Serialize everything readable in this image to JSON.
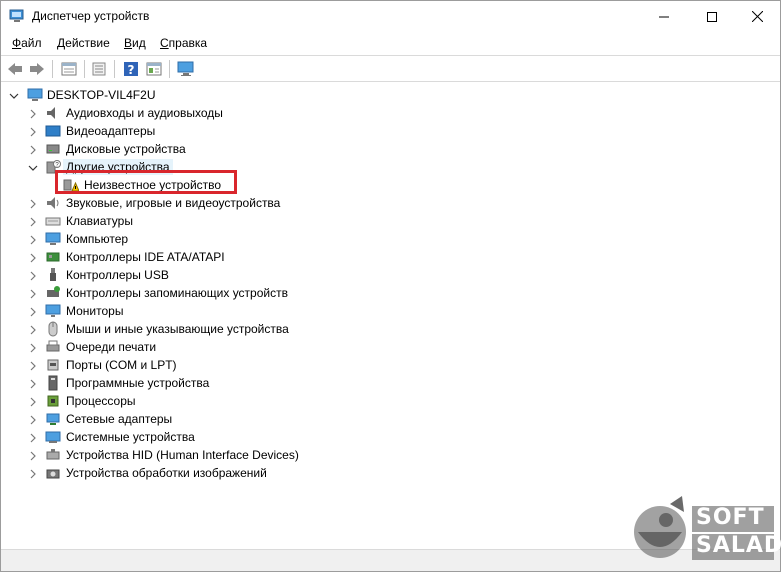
{
  "window": {
    "title": "Диспетчер устройств",
    "buttons": {
      "minimize": "minimize",
      "maximize": "maximize",
      "close": "close"
    }
  },
  "menu": {
    "items": [
      {
        "label_first": "Ф",
        "label_rest": "айл"
      },
      {
        "label_first": "Д",
        "label_rest": "ействие"
      },
      {
        "label_first": "В",
        "label_rest": "ид"
      },
      {
        "label_first": "С",
        "label_rest": "правка"
      }
    ]
  },
  "toolbar": {
    "icons": [
      "back-arrow-icon",
      "forward-arrow-icon",
      "properties-grid-icon",
      "list-view-icon",
      "help-icon",
      "details-view-icon",
      "monitor-scan-icon"
    ]
  },
  "tree": {
    "root": "DESKTOP-VIL4F2U",
    "items": [
      {
        "label": "Аудиовходы и аудиовыходы",
        "icon": "audio-icon",
        "expanded": false
      },
      {
        "label": "Видеоадаптеры",
        "icon": "display-adapter-icon",
        "expanded": false
      },
      {
        "label": "Дисковые устройства",
        "icon": "disk-drive-icon",
        "expanded": false
      },
      {
        "label": "Другие устройства",
        "icon": "other-devices-icon",
        "expanded": true
      },
      {
        "label": "Неизвестное устройство",
        "icon": "warning-device-icon",
        "child": true
      },
      {
        "label": "Звуковые, игровые и видеоустройства",
        "icon": "sound-icon",
        "expanded": false
      },
      {
        "label": "Клавиатуры",
        "icon": "keyboard-icon",
        "expanded": false
      },
      {
        "label": "Компьютер",
        "icon": "computer-icon",
        "expanded": false
      },
      {
        "label": "Контроллеры IDE ATA/ATAPI",
        "icon": "ide-controller-icon",
        "expanded": false
      },
      {
        "label": "Контроллеры USB",
        "icon": "usb-icon",
        "expanded": false
      },
      {
        "label": "Контроллеры запоминающих устройств",
        "icon": "storage-controller-icon",
        "expanded": false
      },
      {
        "label": "Мониторы",
        "icon": "monitor-icon",
        "expanded": false
      },
      {
        "label": "Мыши и иные указывающие устройства",
        "icon": "mouse-icon",
        "expanded": false
      },
      {
        "label": "Очереди печати",
        "icon": "printer-icon",
        "expanded": false
      },
      {
        "label": "Порты (COM и LPT)",
        "icon": "port-icon",
        "expanded": false
      },
      {
        "label": "Программные устройства",
        "icon": "software-device-icon",
        "expanded": false
      },
      {
        "label": "Процессоры",
        "icon": "processor-icon",
        "expanded": false
      },
      {
        "label": "Сетевые адаптеры",
        "icon": "network-adapter-icon",
        "expanded": false
      },
      {
        "label": "Системные устройства",
        "icon": "system-device-icon",
        "expanded": false
      },
      {
        "label": "Устройства HID (Human Interface Devices)",
        "icon": "hid-icon",
        "expanded": false
      },
      {
        "label": "Устройства обработки изображений",
        "icon": "imaging-device-icon",
        "expanded": false
      }
    ]
  },
  "watermark": {
    "line1": "SOFT",
    "line2": "SALAD"
  },
  "colors": {
    "highlight": "#d9262c",
    "selection": "#e5f3fb",
    "accent": "#1e7bd2"
  }
}
